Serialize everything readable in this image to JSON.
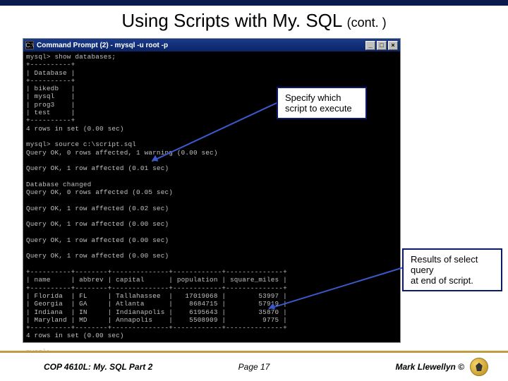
{
  "title_main": "Using Scripts with My. SQL",
  "title_cont": "(cont. )",
  "cmd_title": "Command Prompt (2) - mysql -u root -p",
  "btn_min": "_",
  "btn_max": "□",
  "btn_close": "×",
  "cmd_icon": "C:\\",
  "callout1_l1": "Specify which",
  "callout1_l2": "script to execute",
  "callout2_l1": "Results of select query",
  "callout2_l2": "at end of script.",
  "footer_left": "COP 4610L: My. SQL Part 2",
  "footer_mid": "Page 17",
  "footer_right": "Mark Llewellyn ©",
  "term": {
    "l01": "mysql> show databases;",
    "l02": "+----------+",
    "l03": "| Database |",
    "l04": "+----------+",
    "l05": "| bikedb   |",
    "l06": "| mysql    |",
    "l07": "| prog3    |",
    "l08": "| test     |",
    "l09": "+----------+",
    "l10": "4 rows in set (0.00 sec)",
    "l11": "",
    "l12": "mysql> source c:\\script.sql",
    "l13": "Query OK, 0 rows affected, 1 warning (0.00 sec)",
    "l14": "",
    "l15": "Query OK, 1 row affected (0.01 sec)",
    "l16": "",
    "l17": "Database changed",
    "l18": "Query OK, 0 rows affected (0.05 sec)",
    "l19": "",
    "l20": "Query OK, 1 row affected (0.02 sec)",
    "l21": "",
    "l22": "Query OK, 1 row affected (0.00 sec)",
    "l23": "",
    "l24": "Query OK, 1 row affected (0.00 sec)",
    "l25": "",
    "l26": "Query OK, 1 row affected (0.00 sec)",
    "l27": "",
    "l28": "+----------+--------+--------------+------------+--------------+",
    "l29": "| name     | abbrev | capital      | population | square_miles |",
    "l30": "+----------+--------+--------------+------------+--------------+",
    "l31": "| Florida  | FL     | Tallahassee  |   17019068 |        53997 |",
    "l32": "| Georgia  | GA     | Atlanta      |    8684715 |        57919 |",
    "l33": "| Indiana  | IN     | Indianapolis |    6195643 |        35870 |",
    "l34": "| Maryland | MD     | Annapolis    |    5508909 |         9775 |",
    "l35": "+----------+--------+--------------+------------+--------------+",
    "l36": "4 rows in set (0.00 sec)",
    "l37": "",
    "l38": "mysql>"
  }
}
